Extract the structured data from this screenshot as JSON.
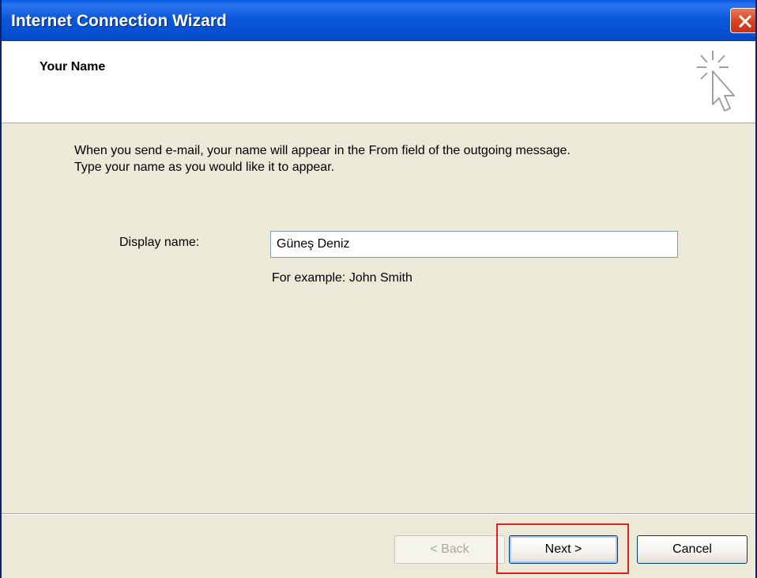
{
  "window": {
    "title": "Internet Connection Wizard"
  },
  "header": {
    "title": "Your Name",
    "icon": "wizard-cursor-sparkle-icon"
  },
  "body": {
    "description_line1": "When you send e-mail, your name will appear in the From field of the outgoing message.",
    "description_line2": "Type your name as you would like it to appear.",
    "display_name_label": "Display name:",
    "display_name_value": "Güneş Deniz",
    "example_text": "For example: John Smith"
  },
  "footer": {
    "back_label": "< Back",
    "next_label": "Next >",
    "cancel_label": "Cancel"
  },
  "colors": {
    "titlebar": "#0a58d8",
    "dialog_background": "#ece9d8",
    "close_button": "#d8421e",
    "highlight_box": "#e02020"
  }
}
